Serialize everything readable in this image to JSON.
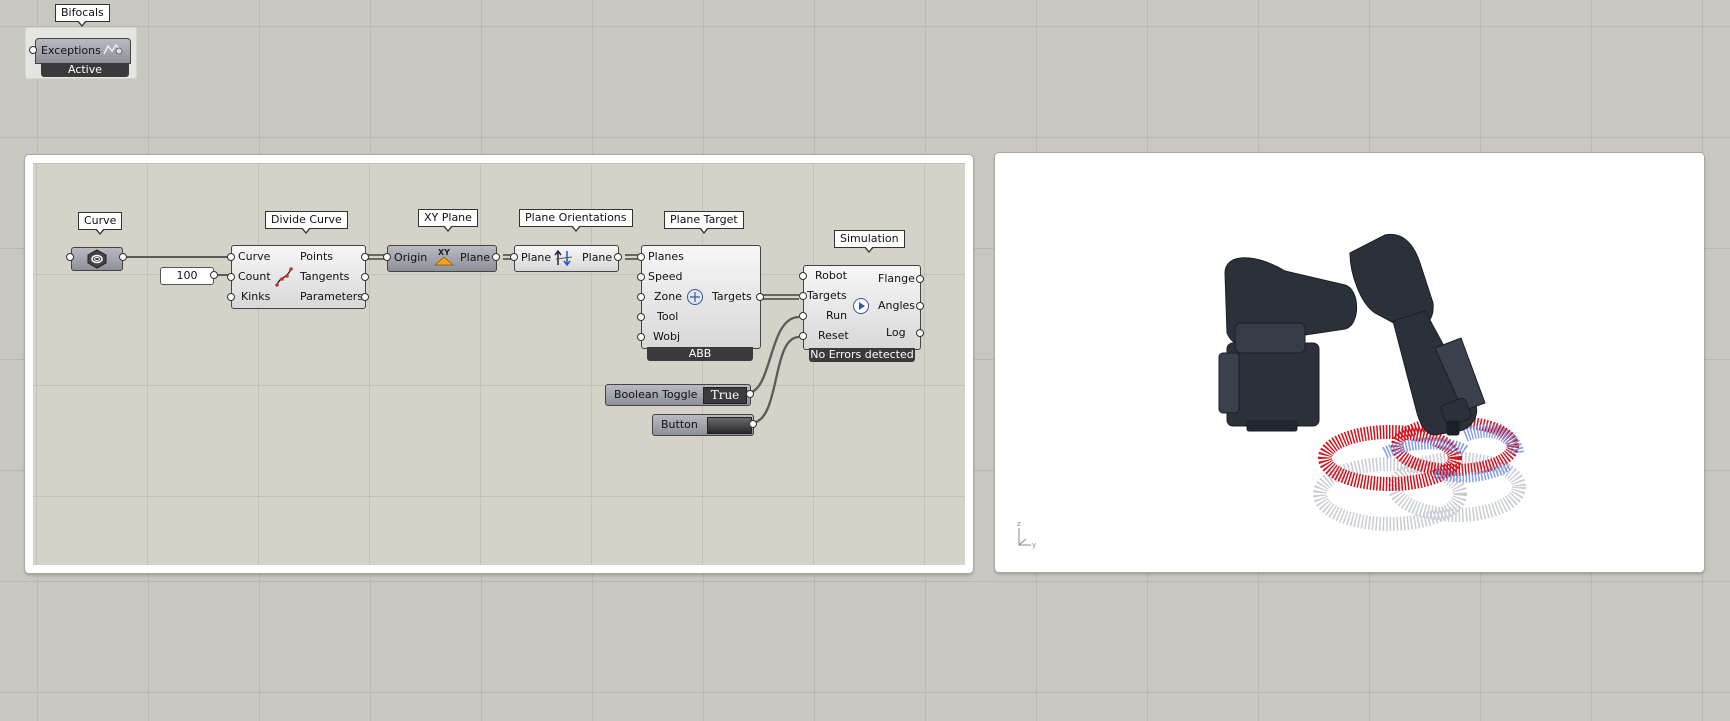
{
  "canvas": {
    "bifocals": {
      "tag": "Bifocals",
      "component_label": "Exceptions",
      "status": "Active"
    }
  },
  "definition": {
    "curve": {
      "tag": "Curve"
    },
    "number_input": {
      "value": "100"
    },
    "divide_curve": {
      "tag": "Divide Curve",
      "inputs": [
        "Curve",
        "Count",
        "Kinks"
      ],
      "outputs": [
        "Points",
        "Tangents",
        "Parameters"
      ]
    },
    "xy_plane": {
      "tag": "XY Plane",
      "input": "Origin",
      "output": "Plane",
      "icon_text": "XY"
    },
    "plane_orientations": {
      "tag": "Plane Orientations",
      "input": "Plane",
      "output": "Plane"
    },
    "plane_target": {
      "tag": "Plane Target",
      "inputs": [
        "Planes",
        "Speed",
        "Zone",
        "Tool",
        "Wobj"
      ],
      "output": "Targets",
      "footer": "ABB"
    },
    "simulation": {
      "tag": "Simulation",
      "inputs": [
        "Robot",
        "Targets",
        "Run",
        "Reset"
      ],
      "outputs": [
        "Flange",
        "Angles",
        "Log"
      ],
      "footer": "No Errors detected"
    },
    "boolean_toggle": {
      "label": "Boolean Toggle",
      "value": "True"
    },
    "button": {
      "label": "Button"
    }
  },
  "viewport": {
    "axis_labels": {
      "z": "z",
      "y": "y"
    },
    "robot_color": "#2b313b",
    "target_colors": {
      "red": "#d6101b",
      "blue": "#6f8fe6",
      "grey": "#b8bcc6"
    }
  }
}
